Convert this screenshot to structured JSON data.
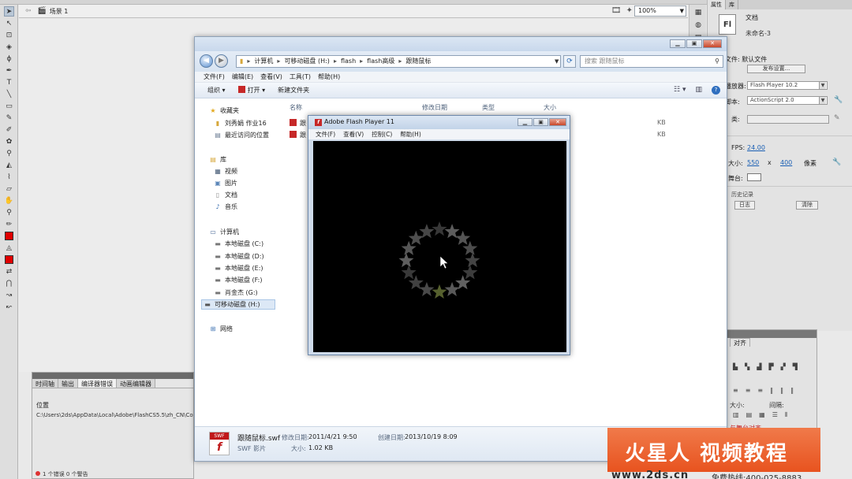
{
  "ide": {
    "scene_label": "场景 1",
    "zoom": "100%",
    "props_tabs": [
      "属性",
      "库"
    ],
    "doc_type": "文档",
    "doc_name": "未命名-3",
    "doc_icon": "Fl",
    "file_label": "文件: 默认文件",
    "publish_btn": "发布设置...",
    "player_label": "播放器:",
    "player_value": "Flash Player 10.2",
    "script_label": "脚本:",
    "script_value": "ActionScript 2.0",
    "class_label": "类:",
    "fps_label": "FPS:",
    "fps_value": "24.00",
    "size_label": "大小:",
    "width": "550",
    "x_sep": "x",
    "height": "400",
    "unit": "像素",
    "stage_label": "舞台:",
    "history_label": "历史记录",
    "log_btn": "日志",
    "clear_btn": "清除",
    "align_tab": "对齐",
    "align_size_label": "大小:",
    "align_spacing_label": "间隔:",
    "align_to_stage": "与舞台对齐",
    "bottom_tabs": [
      "时间轴",
      "输出",
      "编译器错误",
      "动画编辑器"
    ],
    "bottom_col": "位置",
    "bottom_path": "C:\\Users\\2ds\\AppData\\Local\\Adobe\\FlashCS5.5\\zh_CN\\Conf",
    "bottom_status": "1 个错误   0 个警告"
  },
  "explorer": {
    "breadcrumb": [
      "计算机",
      "可移动磁盘 (H:)",
      "flash",
      "flash高级",
      "跟随鼠标"
    ],
    "search_placeholder": "搜索 跟随鼠标",
    "menu": [
      "文件(F)",
      "编辑(E)",
      "查看(V)",
      "工具(T)",
      "帮助(H)"
    ],
    "toolbar": {
      "organize": "组织 ▾",
      "open": "打开 ▾",
      "new_folder": "新建文件夹"
    },
    "nav": {
      "favorites": "收藏夹",
      "fav_items": [
        "刘秀娟 作业16",
        "最近访问的位置"
      ],
      "library": "库",
      "lib_items": [
        "视频",
        "图片",
        "文档",
        "音乐"
      ],
      "computer": "计算机",
      "drives": [
        "本地磁盘 (C:)",
        "本地磁盘 (D:)",
        "本地磁盘 (E:)",
        "本地磁盘 (F:)",
        "肖金杰 (G:)",
        "可移动磁盘 (H:)"
      ],
      "network": "网络"
    },
    "columns": [
      "名称",
      "修改日期",
      "类型",
      "大小"
    ],
    "files": [
      {
        "name": "跟",
        "size": "KB"
      },
      {
        "name": "跟",
        "size": "KB"
      }
    ],
    "details": {
      "file_name": "跟随鼠标.swf",
      "modified_label": "修改日期:",
      "modified": "2011/4/21 9:50",
      "created_label": "创建日期:",
      "created": "2013/10/19 8:09",
      "type": "SWF 影片",
      "size_label": "大小:",
      "size": "1.02 KB",
      "icon_band": "SWF",
      "icon_glyph": "f"
    }
  },
  "player": {
    "title": "Adobe Flash Player 11",
    "menu": [
      "文件(F)",
      "查看(V)",
      "控制(C)",
      "帮助(H)"
    ],
    "stars": {
      "count": 16,
      "ring_radius_ratio": 1.0
    }
  },
  "watermark": {
    "brand": "火星人 视频教程",
    "url": "www.2ds.cn",
    "hotline": "免费热线:400-025-8883"
  },
  "colors": {
    "flash_red": "#c62828",
    "watermark_orange": "#e8531f"
  }
}
